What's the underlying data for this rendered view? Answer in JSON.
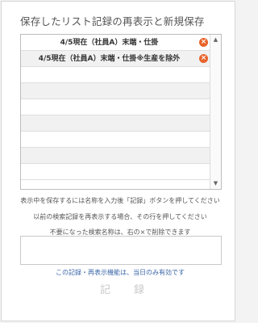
{
  "dialog": {
    "title": "保存したリスト記録の再表示と新規保存"
  },
  "saved_list": {
    "items": [
      {
        "label": "4/5現在（社員A）末端・仕掛"
      },
      {
        "label": "4/5現在（社員A）末端・仕掛※生産を除外"
      }
    ],
    "delete_icon": "×",
    "empty_row_count": 7,
    "scroll_up_icon": "▲",
    "scroll_down_icon": "▼"
  },
  "instructions": {
    "line1": "表示中を保存するには名称を入力後「記録」ボタンを押してください",
    "line2": "以前の検索記録を再表示する場合、その行を押してください",
    "line3": "不要になった検索名称は、右の×で削除できます"
  },
  "name_field": {
    "value": "",
    "placeholder": ""
  },
  "note": "この記録・再表示機能は、当日のみ有効です",
  "save_button": {
    "label": "記　　録"
  },
  "colors": {
    "delete_icon": "#e8632a",
    "note_text": "#3a66a8",
    "disabled_button_text": "#c8c8c8"
  }
}
